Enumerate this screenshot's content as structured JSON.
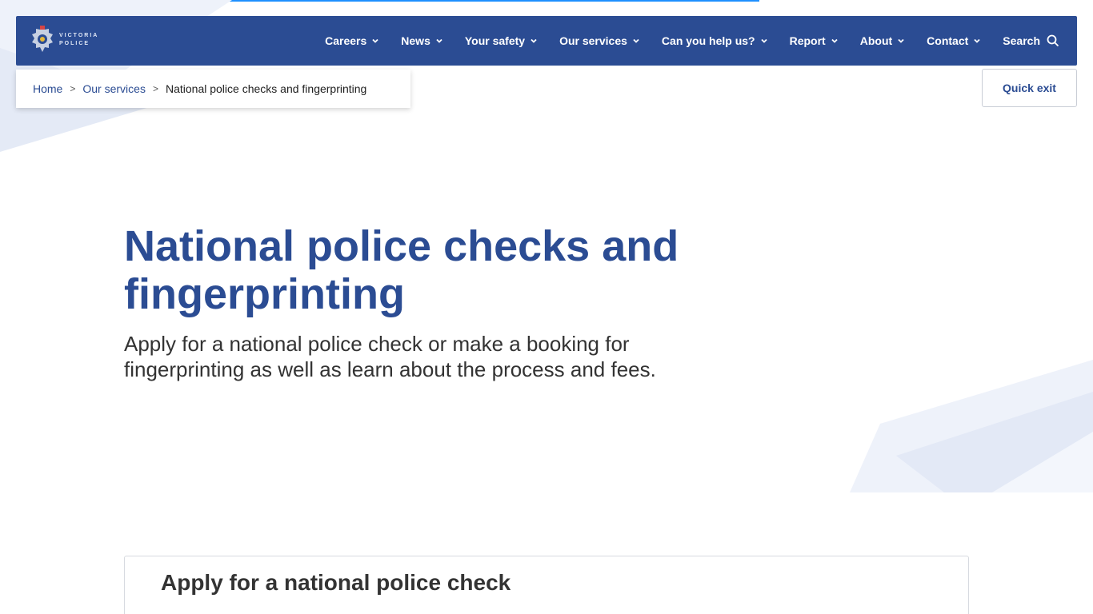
{
  "colors": {
    "brand_blue": "#2b4c93",
    "progress": "#1e90ff",
    "text_dark": "#333333"
  },
  "logo": {
    "line1": "VICTORIA",
    "line2": "POLICE",
    "icon": "victoria-police-badge"
  },
  "nav": {
    "items": [
      {
        "label": "Careers"
      },
      {
        "label": "News"
      },
      {
        "label": "Your safety"
      },
      {
        "label": "Our services"
      },
      {
        "label": "Can you help us?"
      },
      {
        "label": "Report"
      },
      {
        "label": "About"
      },
      {
        "label": "Contact"
      }
    ],
    "search_label": "Search",
    "search_icon": "magnifier-icon"
  },
  "breadcrumb": {
    "home": "Home",
    "separator": ">",
    "section": "Our services",
    "current": "National police checks and fingerprinting"
  },
  "quick_exit": "Quick exit",
  "hero": {
    "title": "National police checks and fingerprinting",
    "intro": "Apply for a national police check or make a booking for fingerprinting as well as learn about the process and fees."
  },
  "card": {
    "title": "Apply for a national police check"
  }
}
